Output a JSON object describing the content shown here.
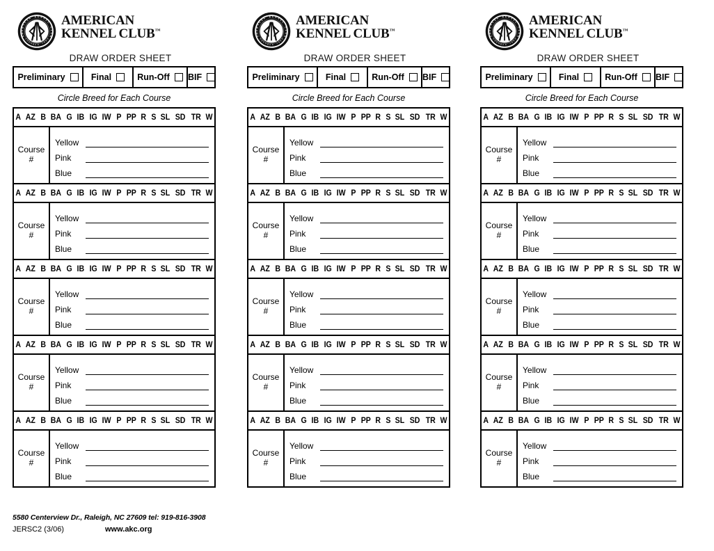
{
  "document": {
    "title": "DRAW ORDER SHEET",
    "org_line_1": "AMERICAN",
    "org_line_2": "KENNEL CLUB",
    "trademark": "™",
    "logo_icon": "akc-seal-logo-icon",
    "instruction": "Circle Breed for Each Course"
  },
  "status_row": {
    "items": [
      {
        "label": "Preliminary",
        "checkbox": "unchecked"
      },
      {
        "label": "Final",
        "checkbox": "unchecked"
      },
      {
        "label": "Run-Off",
        "checkbox": "unchecked"
      },
      {
        "label": "BIF",
        "checkbox": "unchecked"
      }
    ]
  },
  "breed_codes": [
    "A",
    "AZ",
    "B",
    "BA",
    "G",
    "IB",
    "IG",
    "IW",
    "P",
    "PP",
    "R",
    "S",
    "SL",
    "SD",
    "TR",
    "W"
  ],
  "course_block": {
    "course_label": "Course",
    "course_hash": "#",
    "lines": [
      "Yellow",
      "Pink",
      "Blue"
    ]
  },
  "block_count": 5,
  "column_count": 3,
  "footer": {
    "address": "5580 Centerview Dr., Raleigh, NC 27609 tel: 919-816-3908",
    "form_code": "JERSC2 (3/06)",
    "url": "www.akc.org"
  },
  "colors": {
    "ink": "#000000",
    "paper": "#ffffff"
  }
}
